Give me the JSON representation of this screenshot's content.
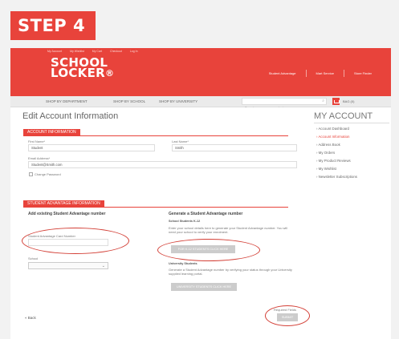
{
  "step_badge": "STEP 4",
  "header": {
    "top_links": [
      "My Account",
      "My Wishlist",
      "My Cart",
      "Checkout",
      "Log In"
    ],
    "logo_line1": "SCHOOL",
    "logo_line2": "LOCKER",
    "logo_mark": "®",
    "links": [
      "Student Advantage",
      "Mart Service",
      "Store Finder"
    ]
  },
  "nav": {
    "items": [
      "SHOP BY DEPARTMENT",
      "SHOP BY SCHOOL",
      "SHOP BY UNIVERSITY"
    ],
    "search_placeholder": "Search our courses, products...",
    "bag_label": "BAG (0)"
  },
  "main": {
    "title": "Edit Account Information",
    "account_section": "ACCOUNT INFORMATION",
    "first_name_label": "First Name*",
    "first_name_value": "Student",
    "last_name_label": "Last Name*",
    "last_name_value": "Smith",
    "email_label": "Email Address*",
    "email_value": "Student@Smith.com",
    "change_password_label": "Change Password",
    "sa_section": "STUDENT ADVANTAGE INFORMATION",
    "add_existing_heading": "Add existing Student Advantage number",
    "card_number_label": "Student Advantage Card Number",
    "school_label": "School",
    "generate_heading": "Generate a Student Advantage number",
    "k12_heading": "School Students K-12",
    "k12_text": "Enter your school details here to generate your Student Advantage number. You will need your school to verify your enrolment.",
    "k12_button": "FOR K-12 STUDENTS CLICK HERE",
    "uni_heading": "University Students",
    "uni_text": "Generate a Student Advantage number by verifying your status through your University supplied learning portal.",
    "uni_button": "UNIVERSITY STUDENTS CLICK HERE",
    "back_link": "« Back",
    "required_text": "Required Fields",
    "save_button": "SUBMIT"
  },
  "sidebar": {
    "title": "MY ACCOUNT",
    "items": [
      {
        "label": "Account Dashboard",
        "active": false
      },
      {
        "label": "Account Information",
        "active": true
      },
      {
        "label": "Address Book",
        "active": false
      },
      {
        "label": "My Orders",
        "active": false
      },
      {
        "label": "My Product Reviews",
        "active": false
      },
      {
        "label": "My Wishlist",
        "active": false
      },
      {
        "label": "Newsletter Subscriptions",
        "active": false
      }
    ]
  },
  "colors": {
    "brand_red": "#e8433b",
    "annotation_red": "#d33f36",
    "disabled_button": "#cccccc"
  }
}
